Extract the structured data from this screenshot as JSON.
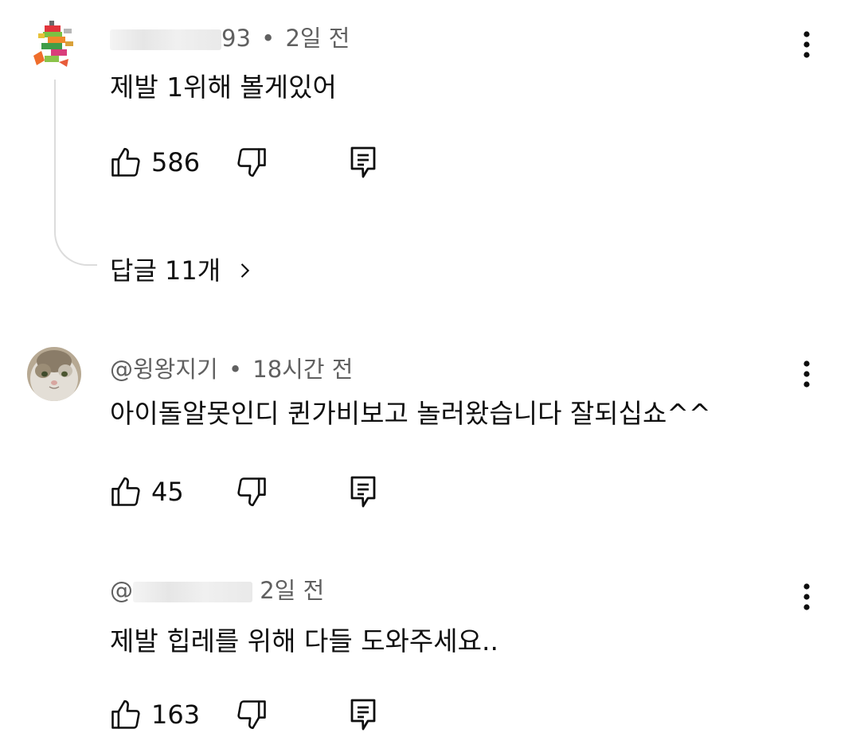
{
  "comments": [
    {
      "author_visible": "93",
      "separator": "•",
      "time": "2일 전",
      "text": "제발 1위해 볼게있어",
      "likes": "586",
      "replies_label": "답글 11개"
    },
    {
      "author_visible": "@윙왕지기",
      "separator": "•",
      "time": "18시간 전",
      "text": "아이돌알못인디 퀸가비보고 놀러왔습니다 잘되십쇼^^",
      "likes": "45"
    },
    {
      "author_visible": "@",
      "time": "2일 전",
      "text": "제발 힙레를 위해 다들 도와주세요..",
      "likes": "163"
    }
  ],
  "icons": {
    "like": "thumbs-up-icon",
    "dislike": "thumbs-down-icon",
    "reply": "comment-reply-icon",
    "more": "more-vertical-icon",
    "chevron": "chevron-right-icon"
  }
}
